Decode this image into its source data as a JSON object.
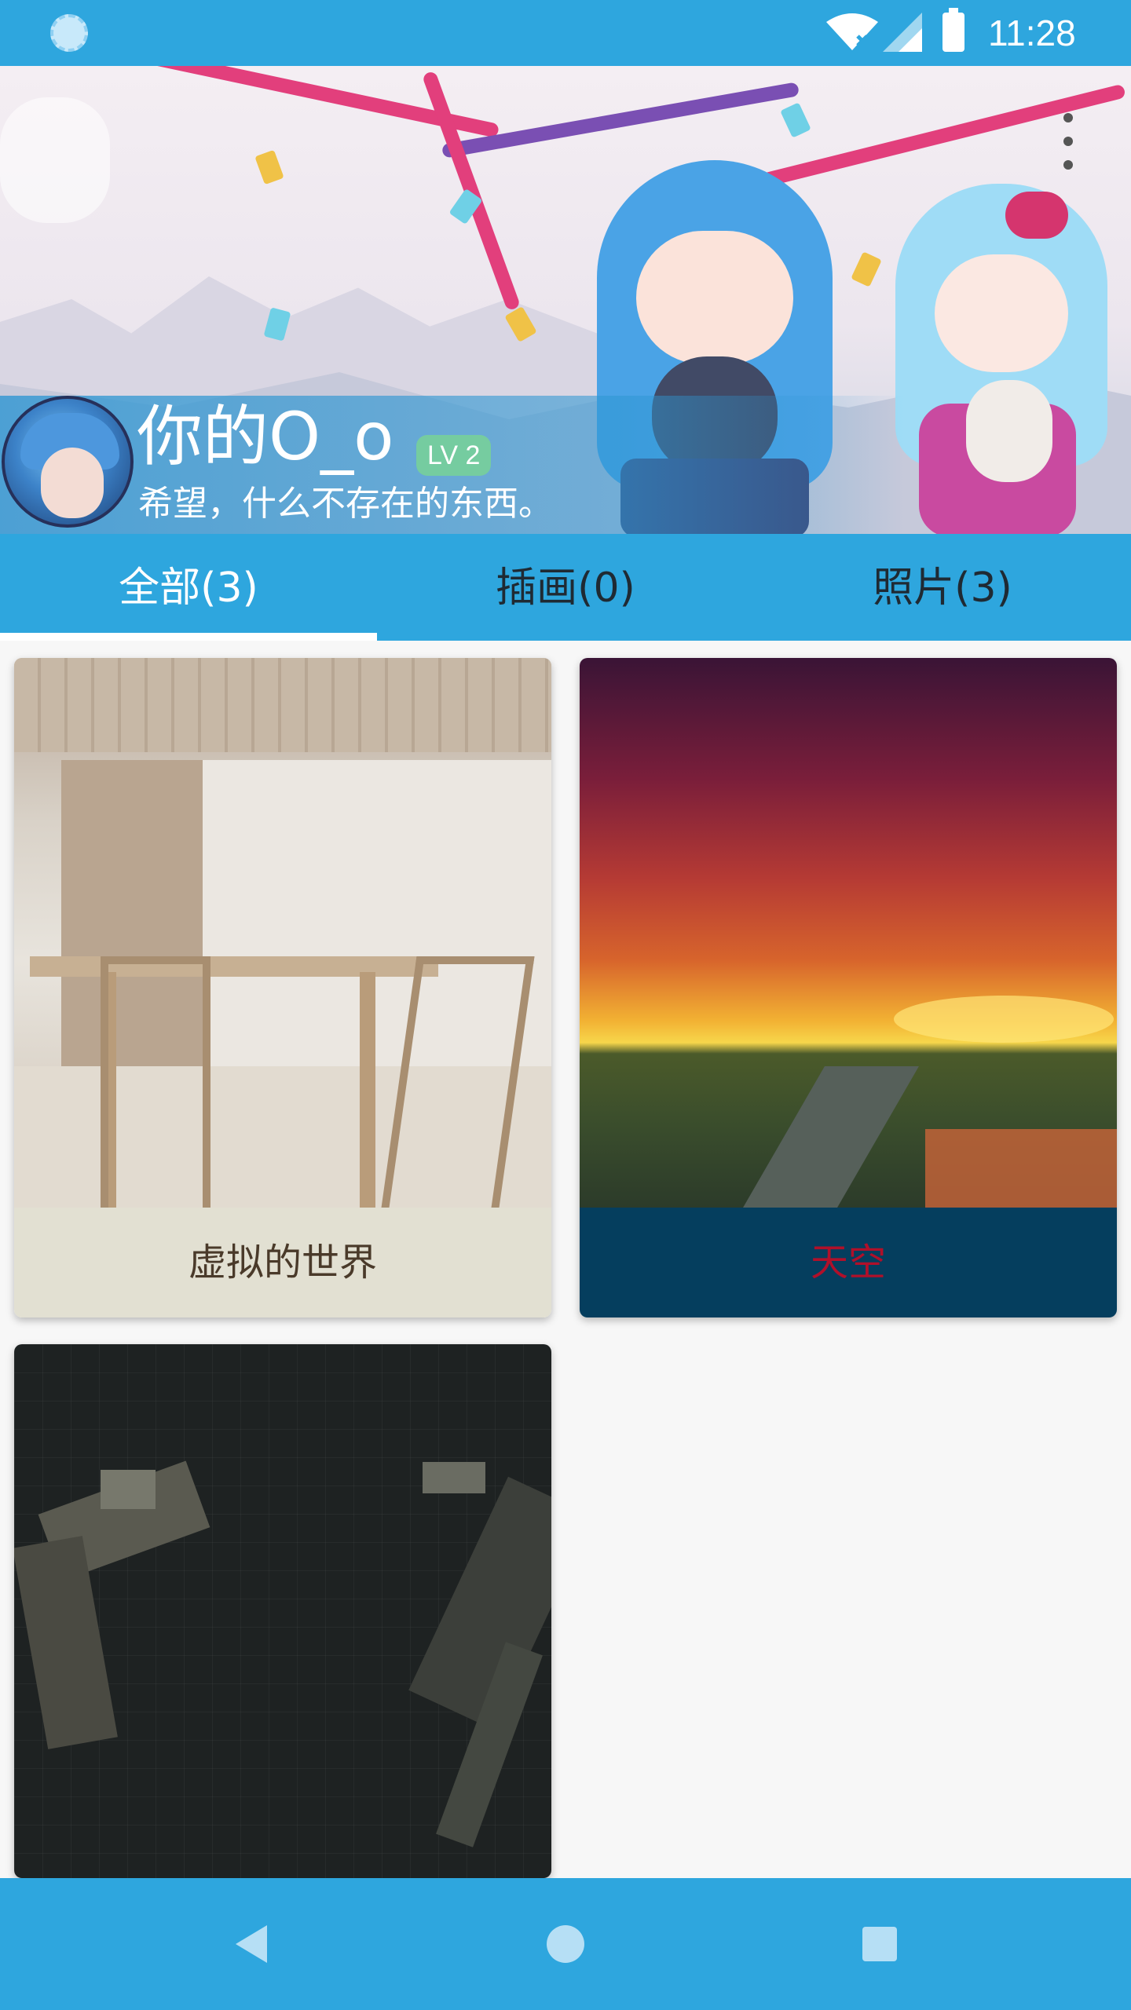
{
  "status_bar": {
    "time": "11:28",
    "icons": [
      "sync-spinner-icon",
      "wifi-icon",
      "cellular-signal-icon",
      "battery-icon"
    ]
  },
  "profile": {
    "username": "你的O_o",
    "level": "LV 2",
    "motto": "希望，什么不存在的东西。"
  },
  "tabs": [
    {
      "label": "全部(3)",
      "active": true
    },
    {
      "label": "插画(0)",
      "active": false
    },
    {
      "label": "照片(3)",
      "active": false
    }
  ],
  "gallery": [
    {
      "title": "虚拟的世界",
      "caption_bg": "#e2e0d2",
      "caption_color": "#4a3a2a"
    },
    {
      "title": "天空",
      "caption_bg": "#053e5e",
      "caption_color": "#b0102a"
    },
    {
      "title": "",
      "caption_bg": "#1e2222",
      "caption_color": "#ffffff"
    }
  ],
  "colors": {
    "primary": "#2ea6de",
    "background": "#f7f7f7"
  },
  "nav_bar": {
    "icons": [
      "back-icon",
      "home-icon",
      "recents-icon"
    ]
  }
}
